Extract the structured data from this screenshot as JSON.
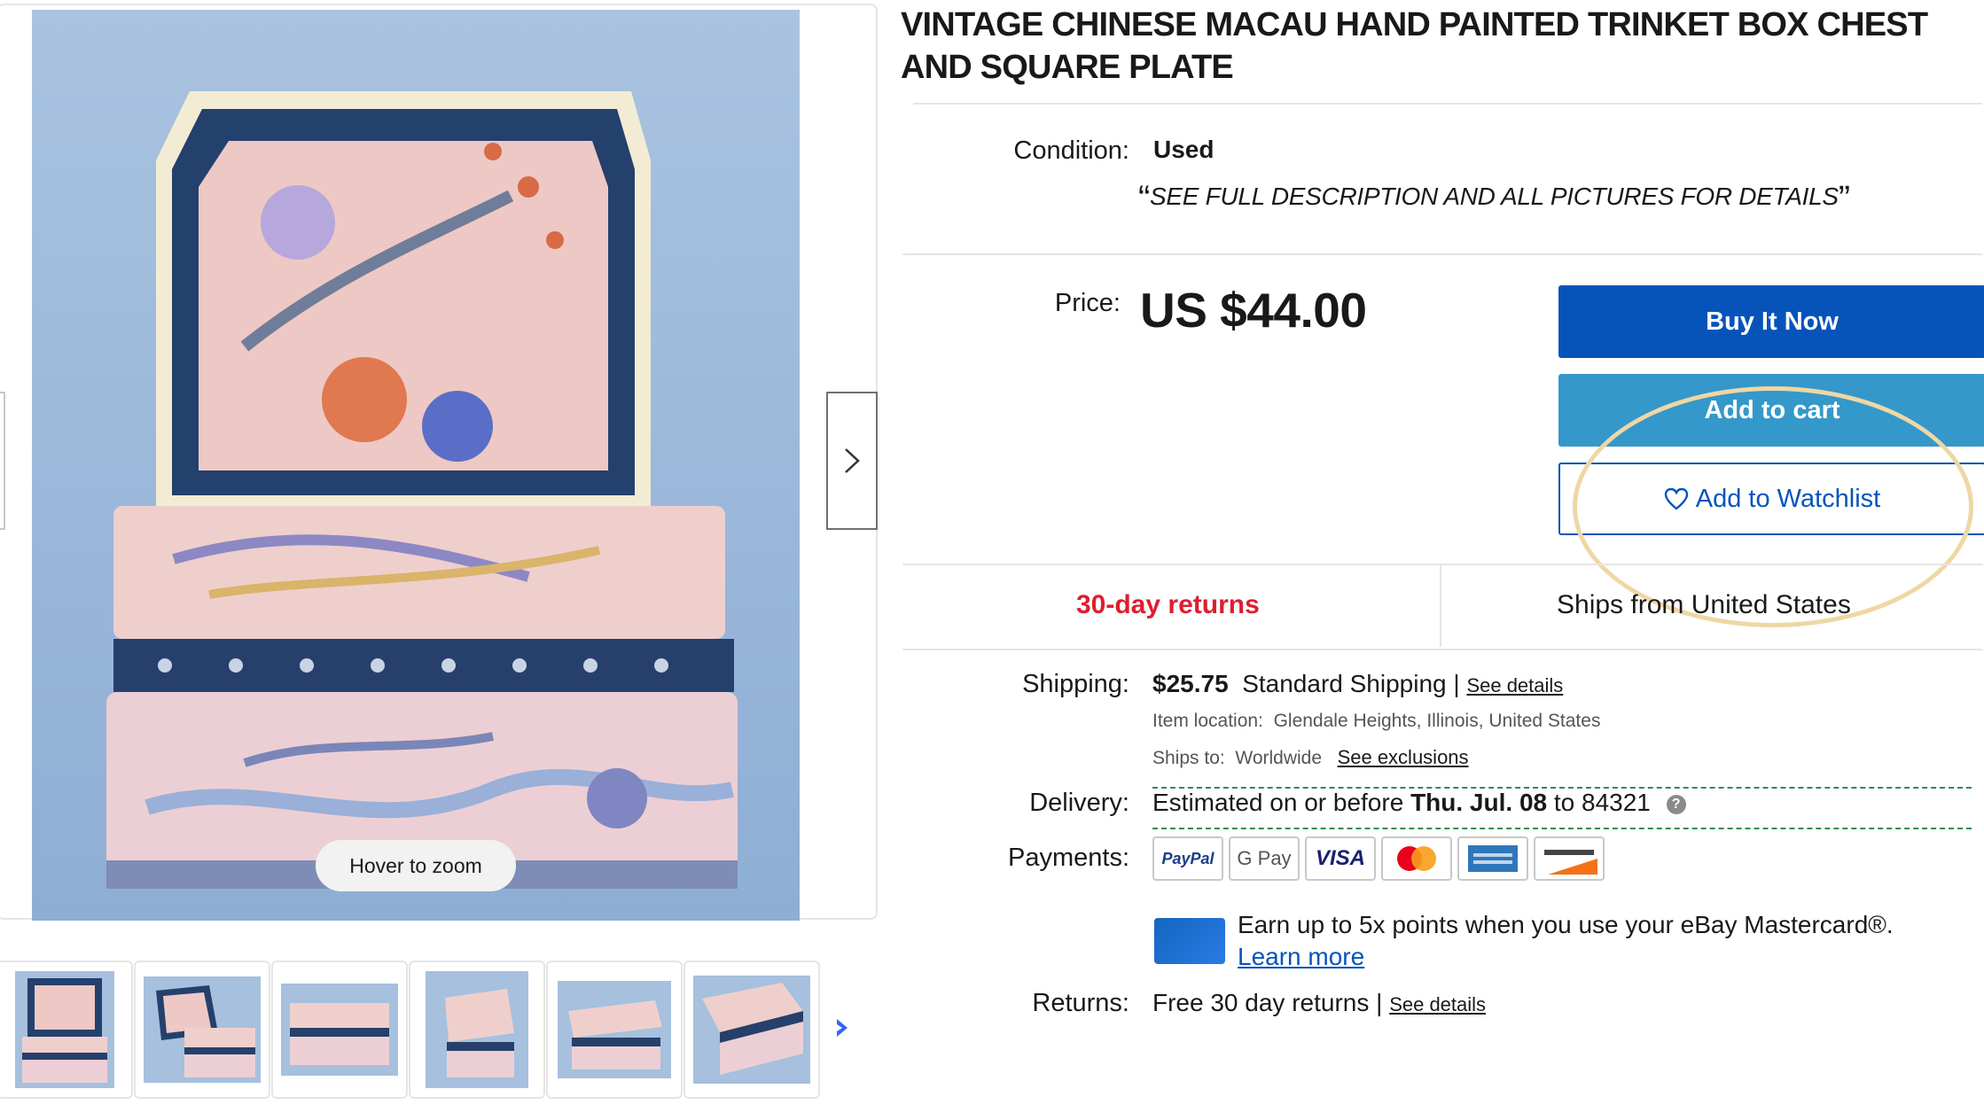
{
  "gallery": {
    "hover_zoom": "Hover to zoom",
    "thumbnail_count": 6
  },
  "item": {
    "title": "VINTAGE CHINESE MACAU HAND PAINTED TRINKET BOX CHEST AND SQUARE PLATE",
    "condition_label": "Condition:",
    "condition_value": "Used",
    "condition_note": "SEE FULL DESCRIPTION AND ALL PICTURES FOR DETAILS",
    "price_label": "Price:",
    "price": "US $44.00"
  },
  "actions": {
    "buy_now": "Buy It Now",
    "add_to_cart": "Add to cart",
    "add_to_watchlist": "Add to Watchlist"
  },
  "highlights": {
    "returns": "30-day returns",
    "ships_from": "Ships from United States"
  },
  "shipping": {
    "label": "Shipping:",
    "price": "$25.75",
    "method": "Standard Shipping |",
    "see_details": "See details",
    "item_location_label": "Item location:",
    "item_location": "Glendale Heights, Illinois, United States",
    "ships_to_label": "Ships to:",
    "ships_to": "Worldwide",
    "see_exclusions": "See exclusions"
  },
  "delivery": {
    "label": "Delivery:",
    "prefix": "Estimated on or before",
    "date": "Thu. Jul. 08",
    "suffix": "to 84321"
  },
  "payments": {
    "label": "Payments:",
    "methods": [
      "PayPal",
      "G Pay",
      "VISA",
      "Mastercard",
      "American Express",
      "Discover"
    ],
    "promo": "Earn up to 5x points when you use your eBay Mastercard®.",
    "learn_more": "Learn more"
  },
  "returns": {
    "label": "Returns:",
    "value": "Free 30 day returns |",
    "see_details": "See details"
  },
  "colors": {
    "buy_now": "#0654ba",
    "add_to_cart": "#3498ca",
    "returns_red": "#dd1e31",
    "annotation_circle": "#efd7a4"
  }
}
